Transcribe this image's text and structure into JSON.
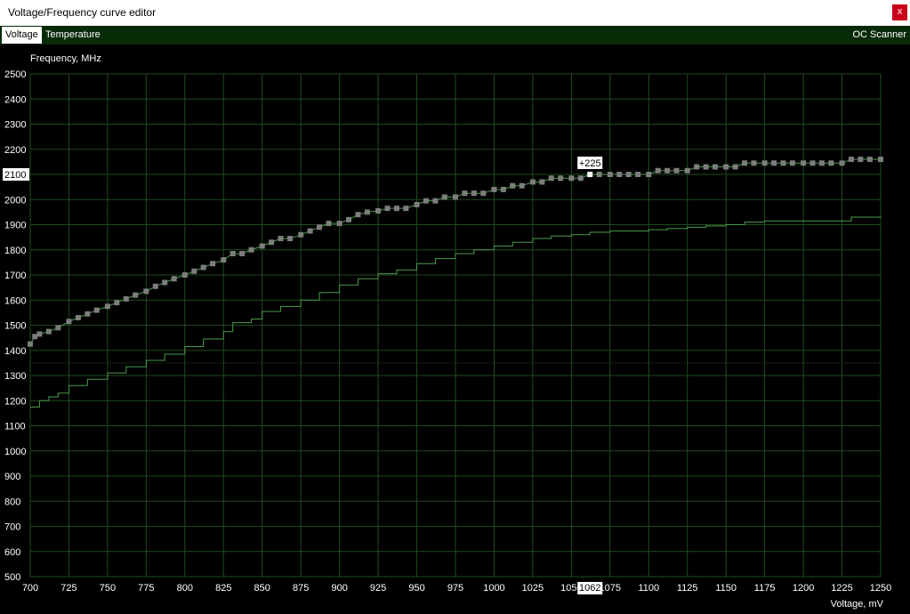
{
  "window": {
    "title": "Voltage/Frequency curve editor",
    "close_label": "x"
  },
  "tabs": [
    {
      "label": "Voltage",
      "active": true
    },
    {
      "label": "Temperature",
      "active": false
    }
  ],
  "oc_scanner_label": "OC Scanner",
  "chart_data": {
    "type": "line",
    "ylabel": "Frequency, MHz",
    "xlabel": "Voltage, mV",
    "xlim": [
      700,
      1250
    ],
    "ylim": [
      500,
      2500
    ],
    "x_ticks": [
      "700",
      "725",
      "750",
      "775",
      "800",
      "825",
      "850",
      "875",
      "900",
      "925",
      "950",
      "975",
      "1000",
      "1025",
      "1050",
      "1075",
      "1100",
      "1125",
      "1150",
      "1175",
      "1200",
      "1225",
      "1250"
    ],
    "y_ticks": [
      "500",
      "600",
      "700",
      "800",
      "900",
      "1000",
      "1100",
      "1200",
      "1300",
      "1400",
      "1500",
      "1600",
      "1700",
      "1800",
      "1900",
      "2000",
      "2100",
      "2200",
      "2300",
      "2400",
      "2500"
    ],
    "grid": true,
    "colors": {
      "grid": "#1f4a1f",
      "curve": "#4a9a4a",
      "point": "#7d7d7d",
      "selected_point": "#ffffff",
      "dotted": "#2d5a2d"
    },
    "selected_point": {
      "x": 1062,
      "y": 2100,
      "offset_label": "+225",
      "x_label": "1062",
      "y_label": "2100"
    },
    "dotted_ref_y": 1350,
    "series": [
      {
        "role": "edited curve",
        "x": [
          700,
          703,
          706,
          712,
          718,
          725,
          731,
          737,
          743,
          750,
          756,
          762,
          768,
          775,
          781,
          787,
          793,
          800,
          806,
          812,
          818,
          825,
          831,
          837,
          843,
          850,
          856,
          862,
          868,
          875,
          881,
          887,
          893,
          900,
          906,
          912,
          918,
          925,
          931,
          937,
          943,
          950,
          956,
          962,
          968,
          975,
          981,
          987,
          993,
          1000,
          1006,
          1012,
          1018,
          1025,
          1031,
          1037,
          1043,
          1050,
          1056,
          1062,
          1068,
          1075,
          1081,
          1087,
          1093,
          1100,
          1106,
          1112,
          1118,
          1125,
          1131,
          1137,
          1143,
          1150,
          1156,
          1162,
          1168,
          1175,
          1181,
          1187,
          1193,
          1200,
          1206,
          1212,
          1218,
          1225,
          1231,
          1237,
          1243,
          1250
        ],
        "y": [
          1425,
          1455,
          1465,
          1475,
          1490,
          1515,
          1530,
          1545,
          1560,
          1575,
          1590,
          1605,
          1620,
          1635,
          1655,
          1670,
          1685,
          1700,
          1715,
          1730,
          1745,
          1760,
          1785,
          1785,
          1800,
          1815,
          1830,
          1845,
          1845,
          1860,
          1875,
          1890,
          1905,
          1905,
          1920,
          1940,
          1950,
          1955,
          1965,
          1965,
          1965,
          1980,
          1995,
          1995,
          2010,
          2010,
          2025,
          2025,
          2025,
          2040,
          2040,
          2055,
          2055,
          2070,
          2070,
          2085,
          2085,
          2085,
          2085,
          2100,
          2100,
          2100,
          2100,
          2100,
          2100,
          2100,
          2115,
          2115,
          2115,
          2115,
          2130,
          2130,
          2130,
          2130,
          2130,
          2145,
          2145,
          2145,
          2145,
          2145,
          2145,
          2145,
          2145,
          2145,
          2145,
          2145,
          2160,
          2160,
          2160,
          2160
        ],
        "markers": true
      },
      {
        "role": "default curve",
        "x": [
          700,
          706,
          712,
          718,
          725,
          737,
          750,
          762,
          775,
          787,
          800,
          812,
          825,
          831,
          843,
          850,
          862,
          875,
          887,
          900,
          912,
          925,
          937,
          950,
          962,
          975,
          987,
          1000,
          1012,
          1025,
          1037,
          1050,
          1062,
          1075,
          1087,
          1100,
          1112,
          1125,
          1137,
          1150,
          1162,
          1175,
          1187,
          1200,
          1212,
          1225,
          1231,
          1250
        ],
        "y": [
          1175,
          1200,
          1215,
          1230,
          1260,
          1285,
          1310,
          1335,
          1360,
          1385,
          1415,
          1445,
          1475,
          1510,
          1525,
          1555,
          1575,
          1600,
          1630,
          1660,
          1685,
          1705,
          1720,
          1745,
          1765,
          1785,
          1800,
          1815,
          1830,
          1845,
          1855,
          1860,
          1870,
          1875,
          1875,
          1880,
          1885,
          1890,
          1895,
          1900,
          1910,
          1915,
          1915,
          1915,
          1915,
          1915,
          1930,
          1935
        ],
        "markers": false
      }
    ]
  }
}
